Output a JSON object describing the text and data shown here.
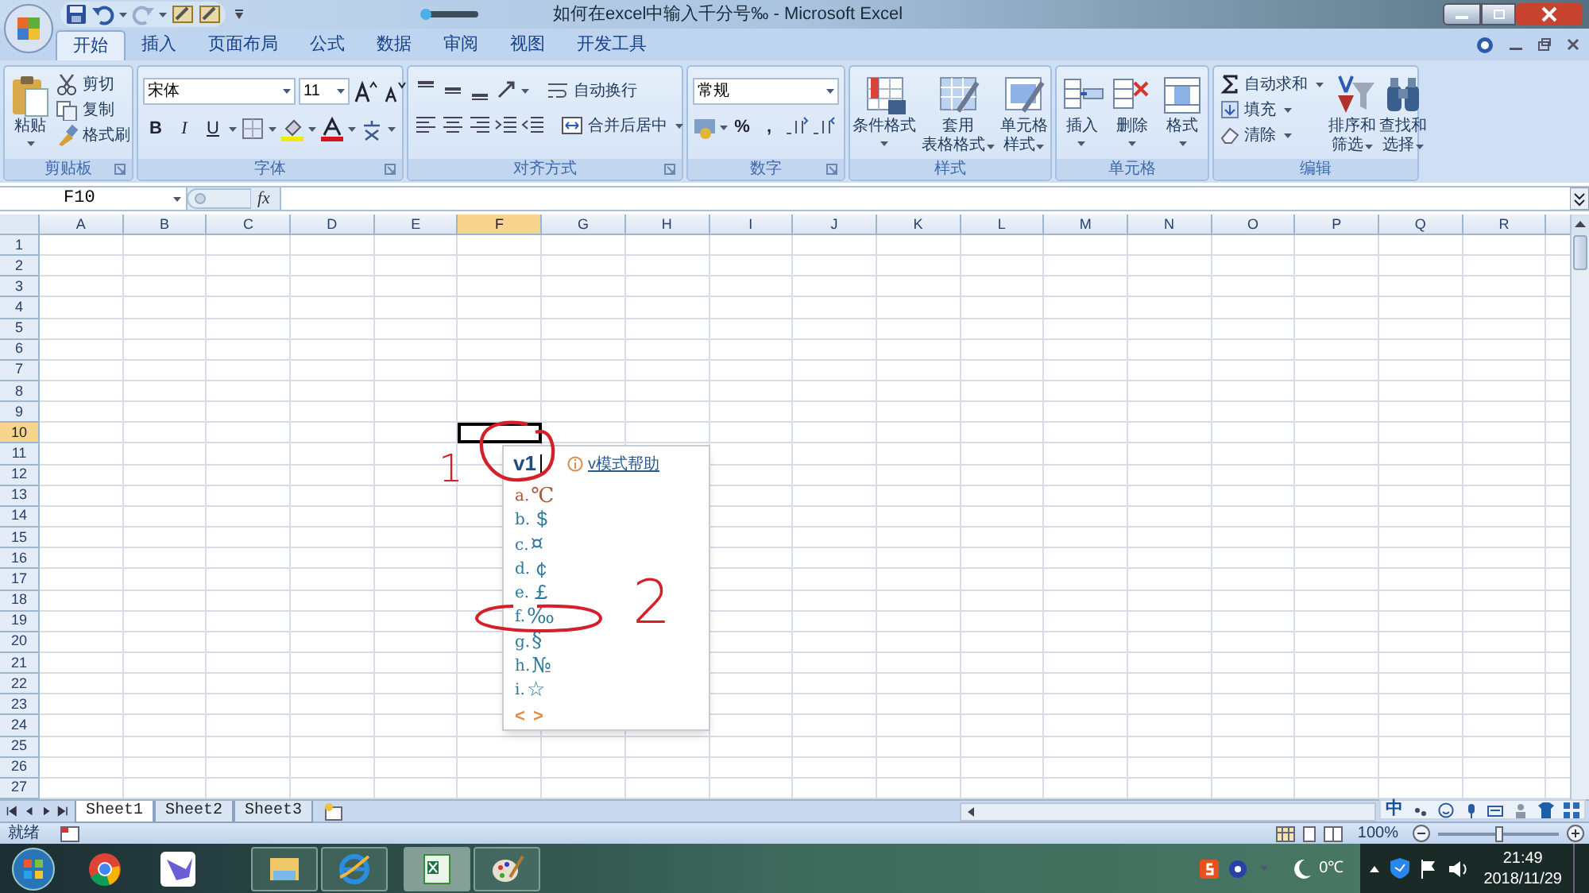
{
  "window": {
    "title": "如何在excel中输入千分号‰ - Microsoft Excel"
  },
  "tabs": [
    {
      "label": "开始",
      "selected": true
    },
    {
      "label": "插入",
      "selected": false
    },
    {
      "label": "页面布局",
      "selected": false
    },
    {
      "label": "公式",
      "selected": false
    },
    {
      "label": "数据",
      "selected": false
    },
    {
      "label": "审阅",
      "selected": false
    },
    {
      "label": "视图",
      "selected": false
    },
    {
      "label": "开发工具",
      "selected": false
    }
  ],
  "ribbon": [
    {
      "kind": "clipboard",
      "title": "剪贴板",
      "paste": "粘贴",
      "items": [
        "剪切",
        "复制",
        "格式刷"
      ]
    },
    {
      "kind": "font",
      "title": "字体",
      "font": "宋体",
      "size": "11",
      "styles": [
        "B",
        "I",
        "U"
      ]
    },
    {
      "kind": "alignment",
      "title": "对齐方式",
      "items": [
        "自动换行",
        "合并后居中"
      ]
    },
    {
      "kind": "number",
      "title": "数字",
      "format": "常规",
      "symbols": [
        "%",
        ","
      ]
    },
    {
      "kind": "styles",
      "title": "样式",
      "buttons": [
        {
          "lines": [
            "条件格式"
          ]
        },
        {
          "lines": [
            "套用",
            "表格格式"
          ]
        },
        {
          "lines": [
            "单元格",
            "样式"
          ]
        }
      ]
    },
    {
      "kind": "cells",
      "title": "单元格",
      "buttons": [
        {
          "lines": [
            "插入"
          ]
        },
        {
          "lines": [
            "删除"
          ]
        },
        {
          "lines": [
            "格式"
          ]
        }
      ]
    },
    {
      "kind": "editing",
      "title": "编辑",
      "items": [
        "自动求和",
        "填充",
        "清除"
      ],
      "buttons": [
        {
          "lines": [
            "排序和",
            "筛选"
          ]
        },
        {
          "lines": [
            "查找和",
            "选择"
          ]
        }
      ]
    }
  ],
  "formula_bar": {
    "name_box": "F10",
    "fx": "fx"
  },
  "sheet": {
    "columns": [
      {
        "label": "A",
        "selected": false
      },
      {
        "label": "B",
        "selected": false
      },
      {
        "label": "C",
        "selected": false
      },
      {
        "label": "D",
        "selected": false
      },
      {
        "label": "E",
        "selected": false
      },
      {
        "label": "F",
        "selected": true
      },
      {
        "label": "G",
        "selected": false
      },
      {
        "label": "H",
        "selected": false
      },
      {
        "label": "I",
        "selected": false
      },
      {
        "label": "J",
        "selected": false
      },
      {
        "label": "K",
        "selected": false
      },
      {
        "label": "L",
        "selected": false
      },
      {
        "label": "M",
        "selected": false
      },
      {
        "label": "N",
        "selected": false
      },
      {
        "label": "O",
        "selected": false
      },
      {
        "label": "P",
        "selected": false
      },
      {
        "label": "Q",
        "selected": false
      },
      {
        "label": "R",
        "selected": false
      }
    ],
    "rows": [
      {
        "label": "1",
        "selected": false
      },
      {
        "label": "2",
        "selected": false
      },
      {
        "label": "3",
        "selected": false
      },
      {
        "label": "4",
        "selected": false
      },
      {
        "label": "5",
        "selected": false
      },
      {
        "label": "6",
        "selected": false
      },
      {
        "label": "7",
        "selected": false
      },
      {
        "label": "8",
        "selected": false
      },
      {
        "label": "9",
        "selected": false
      },
      {
        "label": "10",
        "selected": true
      },
      {
        "label": "11",
        "selected": false
      },
      {
        "label": "12",
        "selected": false
      },
      {
        "label": "13",
        "selected": false
      },
      {
        "label": "14",
        "selected": false
      },
      {
        "label": "15",
        "selected": false
      },
      {
        "label": "16",
        "selected": false
      },
      {
        "label": "17",
        "selected": false
      },
      {
        "label": "18",
        "selected": false
      },
      {
        "label": "19",
        "selected": false
      },
      {
        "label": "20",
        "selected": false
      },
      {
        "label": "21",
        "selected": false
      },
      {
        "label": "22",
        "selected": false
      },
      {
        "label": "23",
        "selected": false
      },
      {
        "label": "24",
        "selected": false
      },
      {
        "label": "25",
        "selected": false
      },
      {
        "label": "26",
        "selected": false
      },
      {
        "label": "27",
        "selected": false
      }
    ]
  },
  "ime": {
    "input": "v1",
    "help": "v模式帮助",
    "candidates": [
      {
        "key": "a.",
        "symbol": "℃",
        "selected": true
      },
      {
        "key": "b.",
        "symbol": "＄",
        "selected": false
      },
      {
        "key": "c.",
        "symbol": "¤",
        "selected": false
      },
      {
        "key": "d.",
        "symbol": "￠",
        "selected": false
      },
      {
        "key": "e.",
        "symbol": "￡",
        "selected": false
      },
      {
        "key": "f.",
        "symbol": "‰",
        "selected": false
      },
      {
        "key": "g.",
        "symbol": "§",
        "selected": false
      },
      {
        "key": "h.",
        "symbol": "№",
        "selected": false
      },
      {
        "key": "i.",
        "symbol": "☆",
        "selected": false
      }
    ],
    "nav": [
      "<",
      ">"
    ]
  },
  "annotations": [
    "1",
    "2"
  ],
  "sheet_tabs": [
    {
      "label": "Sheet1",
      "selected": true
    },
    {
      "label": "Sheet2",
      "selected": false
    },
    {
      "label": "Sheet3",
      "selected": false
    }
  ],
  "ime_toolbar": {
    "label": "中"
  },
  "status_bar": {
    "status": "就绪",
    "zoom": {
      "label": "100%",
      "level": 0.5
    }
  },
  "taskbar": {
    "buttons": [
      {
        "selected": false
      },
      {
        "selected": false
      },
      {
        "selected": false
      },
      {
        "selected": false
      },
      {
        "selected": true
      },
      {
        "selected": false
      }
    ],
    "temperature": "0℃",
    "time": "21:49",
    "date": "2018/11/29"
  }
}
